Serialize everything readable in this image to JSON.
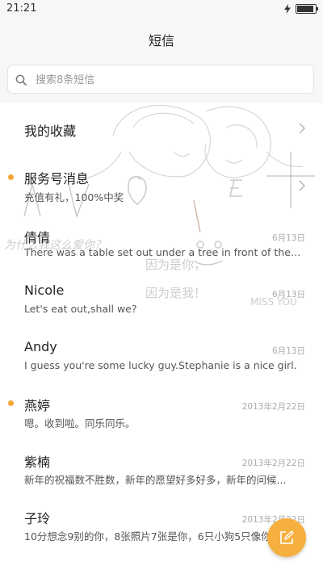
{
  "status_bar": {
    "time": "21:21",
    "charging_icon": "bolt-icon",
    "battery_icon": "battery-icon",
    "battery_level": 0.9
  },
  "header": {
    "title": "短信"
  },
  "search": {
    "placeholder": "搜索8条短信",
    "icon": "search-icon"
  },
  "favorites": {
    "label": "我的收藏",
    "icon": "chevron-right-icon"
  },
  "service": {
    "label": "服务号消息",
    "preview": "充值有礼，100%中奖",
    "unread": true,
    "icon": "chevron-right-icon"
  },
  "conversations": [
    {
      "name": "倩倩",
      "preview": "There was a table set out under a tree in front of the ho...",
      "date": "6月13日",
      "unread": false
    },
    {
      "name": "Nicole",
      "preview": "Let's eat out,shall we?",
      "date": "6月13日",
      "unread": false
    },
    {
      "name": "Andy",
      "preview": "I guess you're some lucky guy.Stephanie is a nice girl.",
      "date": "6月13日",
      "unread": false
    },
    {
      "name": "燕婷",
      "preview": "嗯。收到啦。同乐同乐。",
      "date": "2013年2月22日",
      "unread": true
    },
    {
      "name": "紫楠",
      "preview": "新年的祝福数不胜数，新年的愿望好多好多，新年的问候...",
      "date": "2013年2月22日",
      "unread": false
    },
    {
      "name": "子玲",
      "preview": "10分想念9别的你，8张照片7张是你，6只小狗5只像你",
      "date": "2013年2月22日",
      "unread": false
    }
  ],
  "background_art": {
    "words": [
      "LOVE",
      "为什么我这么爱你？",
      "因为是你，",
      "因为是我！",
      "MISS YOU"
    ]
  },
  "compose_button": {
    "icon": "compose-icon"
  },
  "colors": {
    "accent": "#f6b03f",
    "unread_dot": "#f0a732",
    "background": "#f7f7f7"
  }
}
